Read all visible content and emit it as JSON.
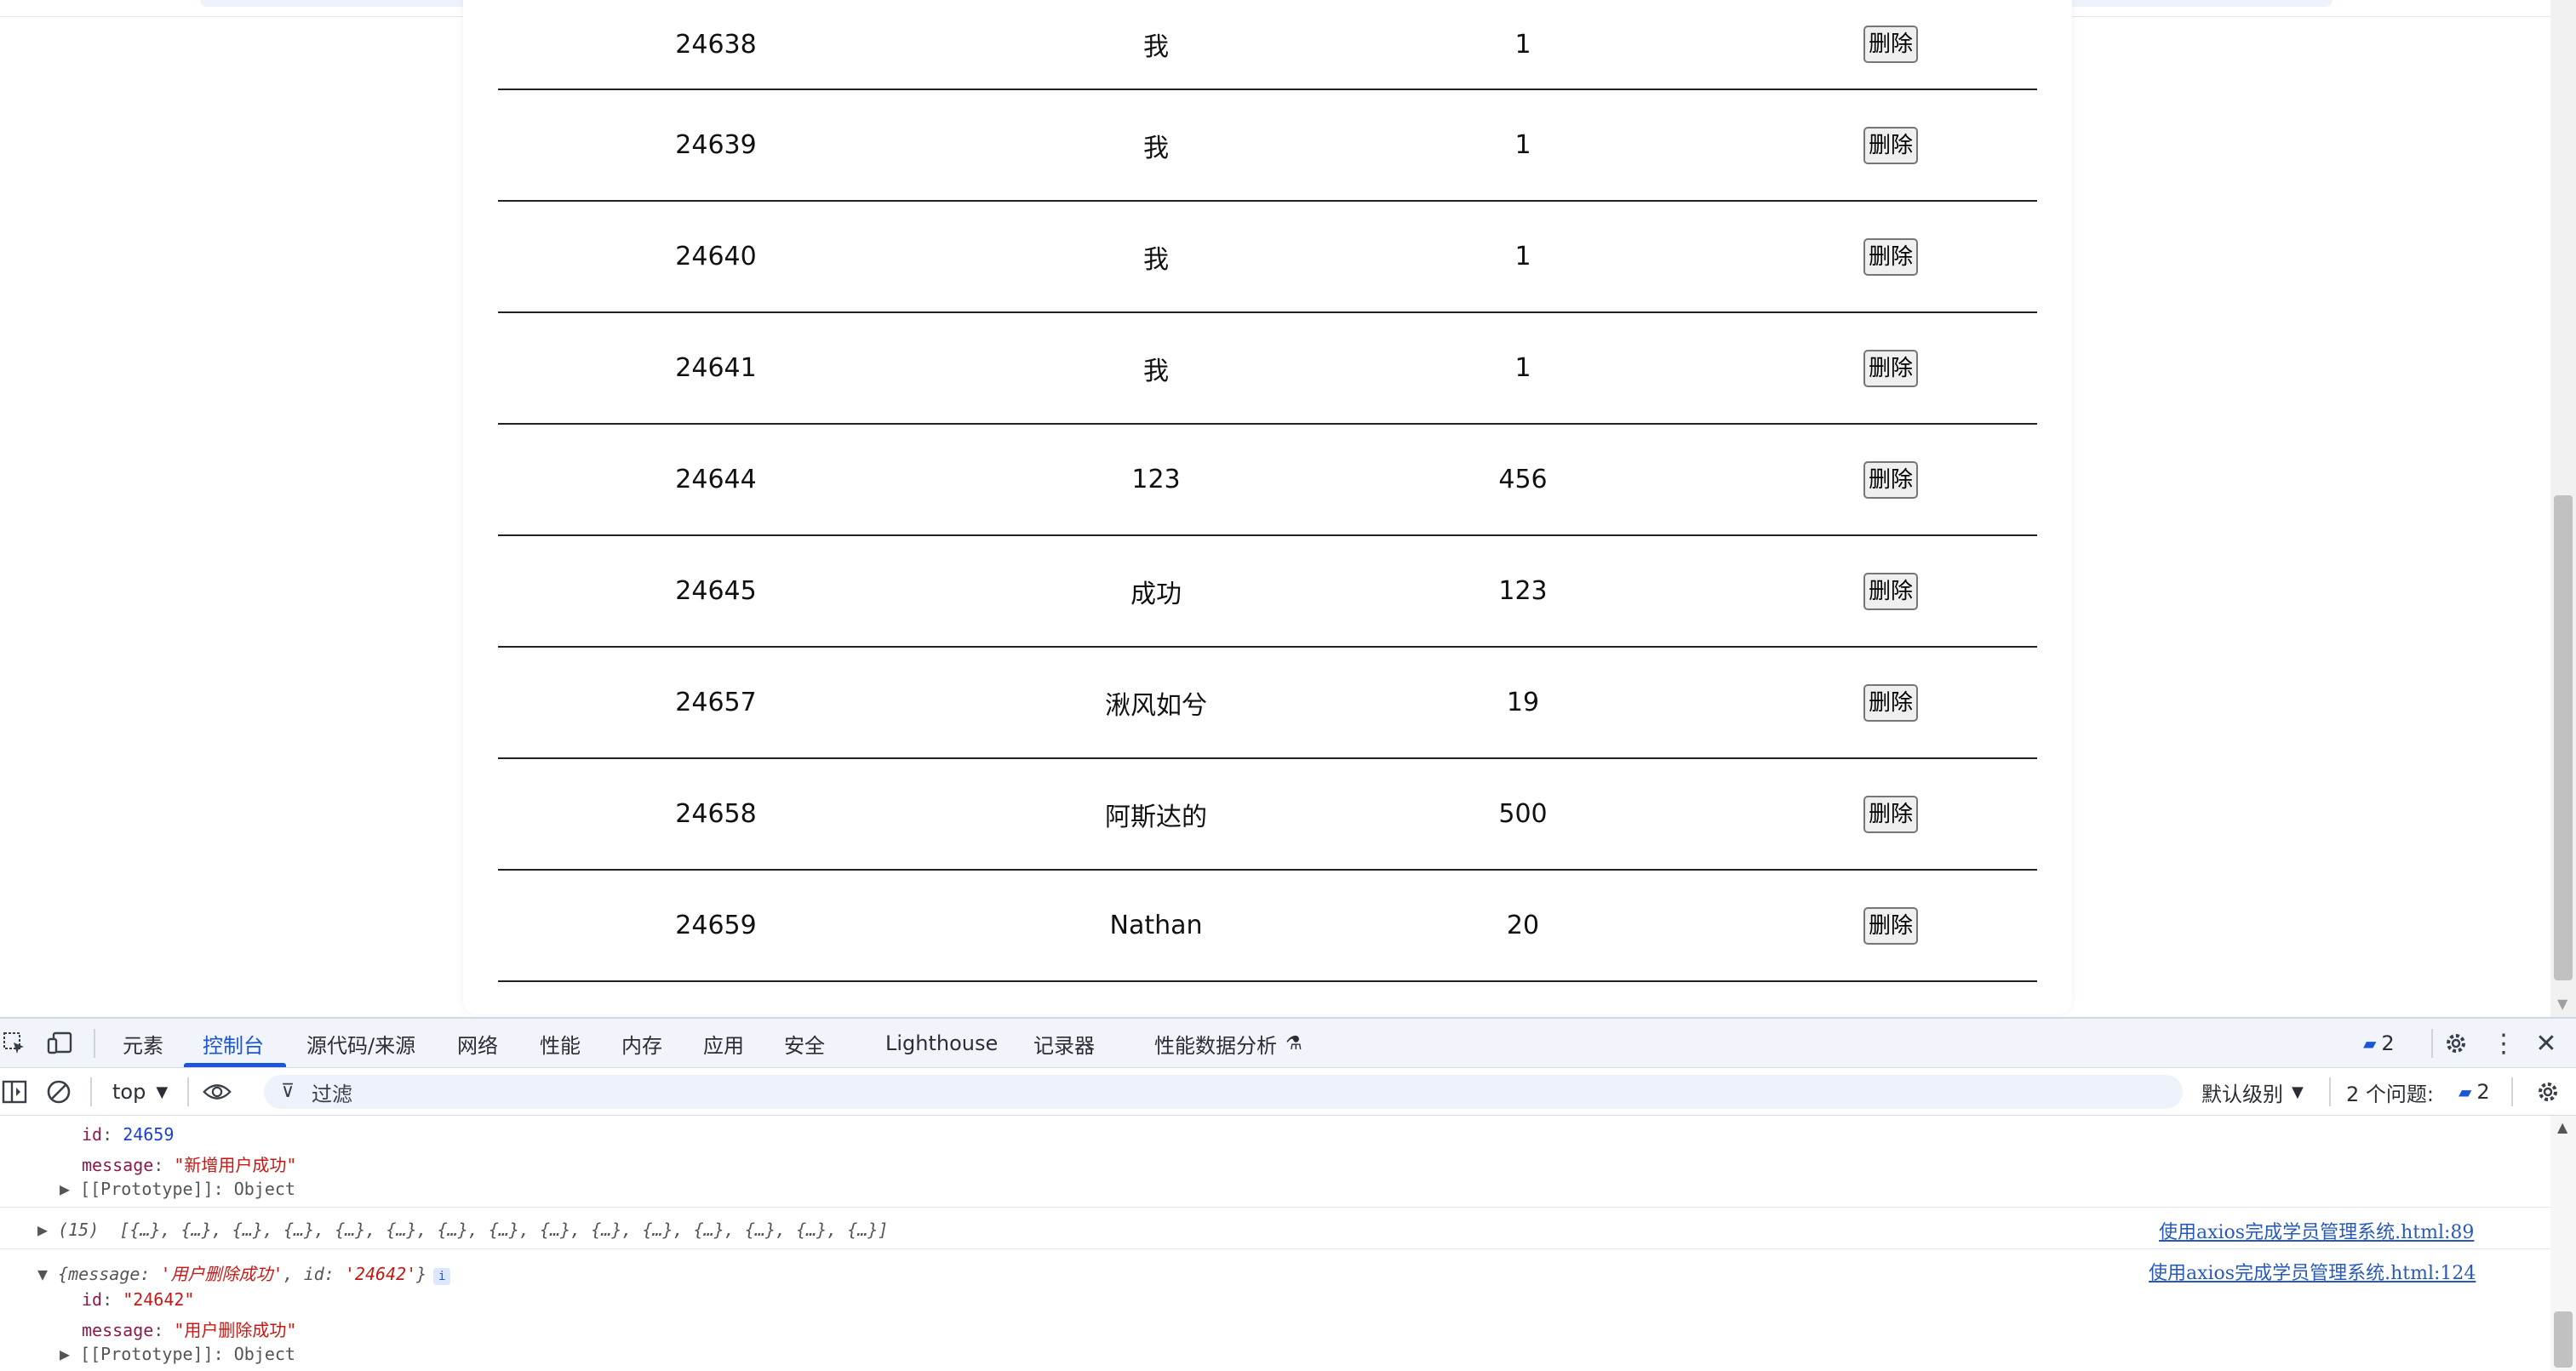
{
  "table": {
    "rows": [
      {
        "id": "24638",
        "name": "我",
        "value": "1",
        "action": "删除"
      },
      {
        "id": "24639",
        "name": "我",
        "value": "1",
        "action": "删除"
      },
      {
        "id": "24640",
        "name": "我",
        "value": "1",
        "action": "删除"
      },
      {
        "id": "24641",
        "name": "我",
        "value": "1",
        "action": "删除"
      },
      {
        "id": "24644",
        "name": "123",
        "value": "456",
        "action": "删除"
      },
      {
        "id": "24645",
        "name": "成功",
        "value": "123",
        "action": "删除"
      },
      {
        "id": "24657",
        "name": "湫风如兮",
        "value": "19",
        "action": "删除"
      },
      {
        "id": "24658",
        "name": "阿斯达的",
        "value": "500",
        "action": "删除"
      },
      {
        "id": "24659",
        "name": "Nathan",
        "value": "20",
        "action": "删除"
      }
    ]
  },
  "devtools": {
    "tabs": [
      "元素",
      "控制台",
      "源代码/来源",
      "网络",
      "性能",
      "内存",
      "应用",
      "安全",
      "Lighthouse",
      "记录器",
      "性能数据分析"
    ],
    "active_tab": "控制台",
    "issues_badge": "2",
    "context": "top",
    "filter_placeholder": "过滤",
    "level": "默认级别",
    "issues_label": "2 个问题:",
    "issues_count": "2"
  },
  "console": {
    "l1_key": "id",
    "l1_val": "24659",
    "l2_key": "message",
    "l2_val": "\"新增用户成功\"",
    "l3": "[[Prototype]]: Object",
    "array_count": "(15)",
    "array_body": "[{…}, {…}, {…}, {…}, {…}, {…}, {…}, {…}, {…}, {…}, {…}, {…}, {…}, {…}, {…}]",
    "array_src": "使用axios完成学员管理系统.html:89",
    "obj_prefix": "{message: ",
    "obj_msg": "'用户删除成功'",
    "obj_mid": ", id: ",
    "obj_id": "'24642'",
    "obj_suffix": "}",
    "obj_src": "使用axios完成学员管理系统.html:124",
    "o1_key": "id",
    "o1_val": "\"24642\"",
    "o2_key": "message",
    "o2_val": "\"用户删除成功\"",
    "o3": "[[Prototype]]: Object"
  }
}
